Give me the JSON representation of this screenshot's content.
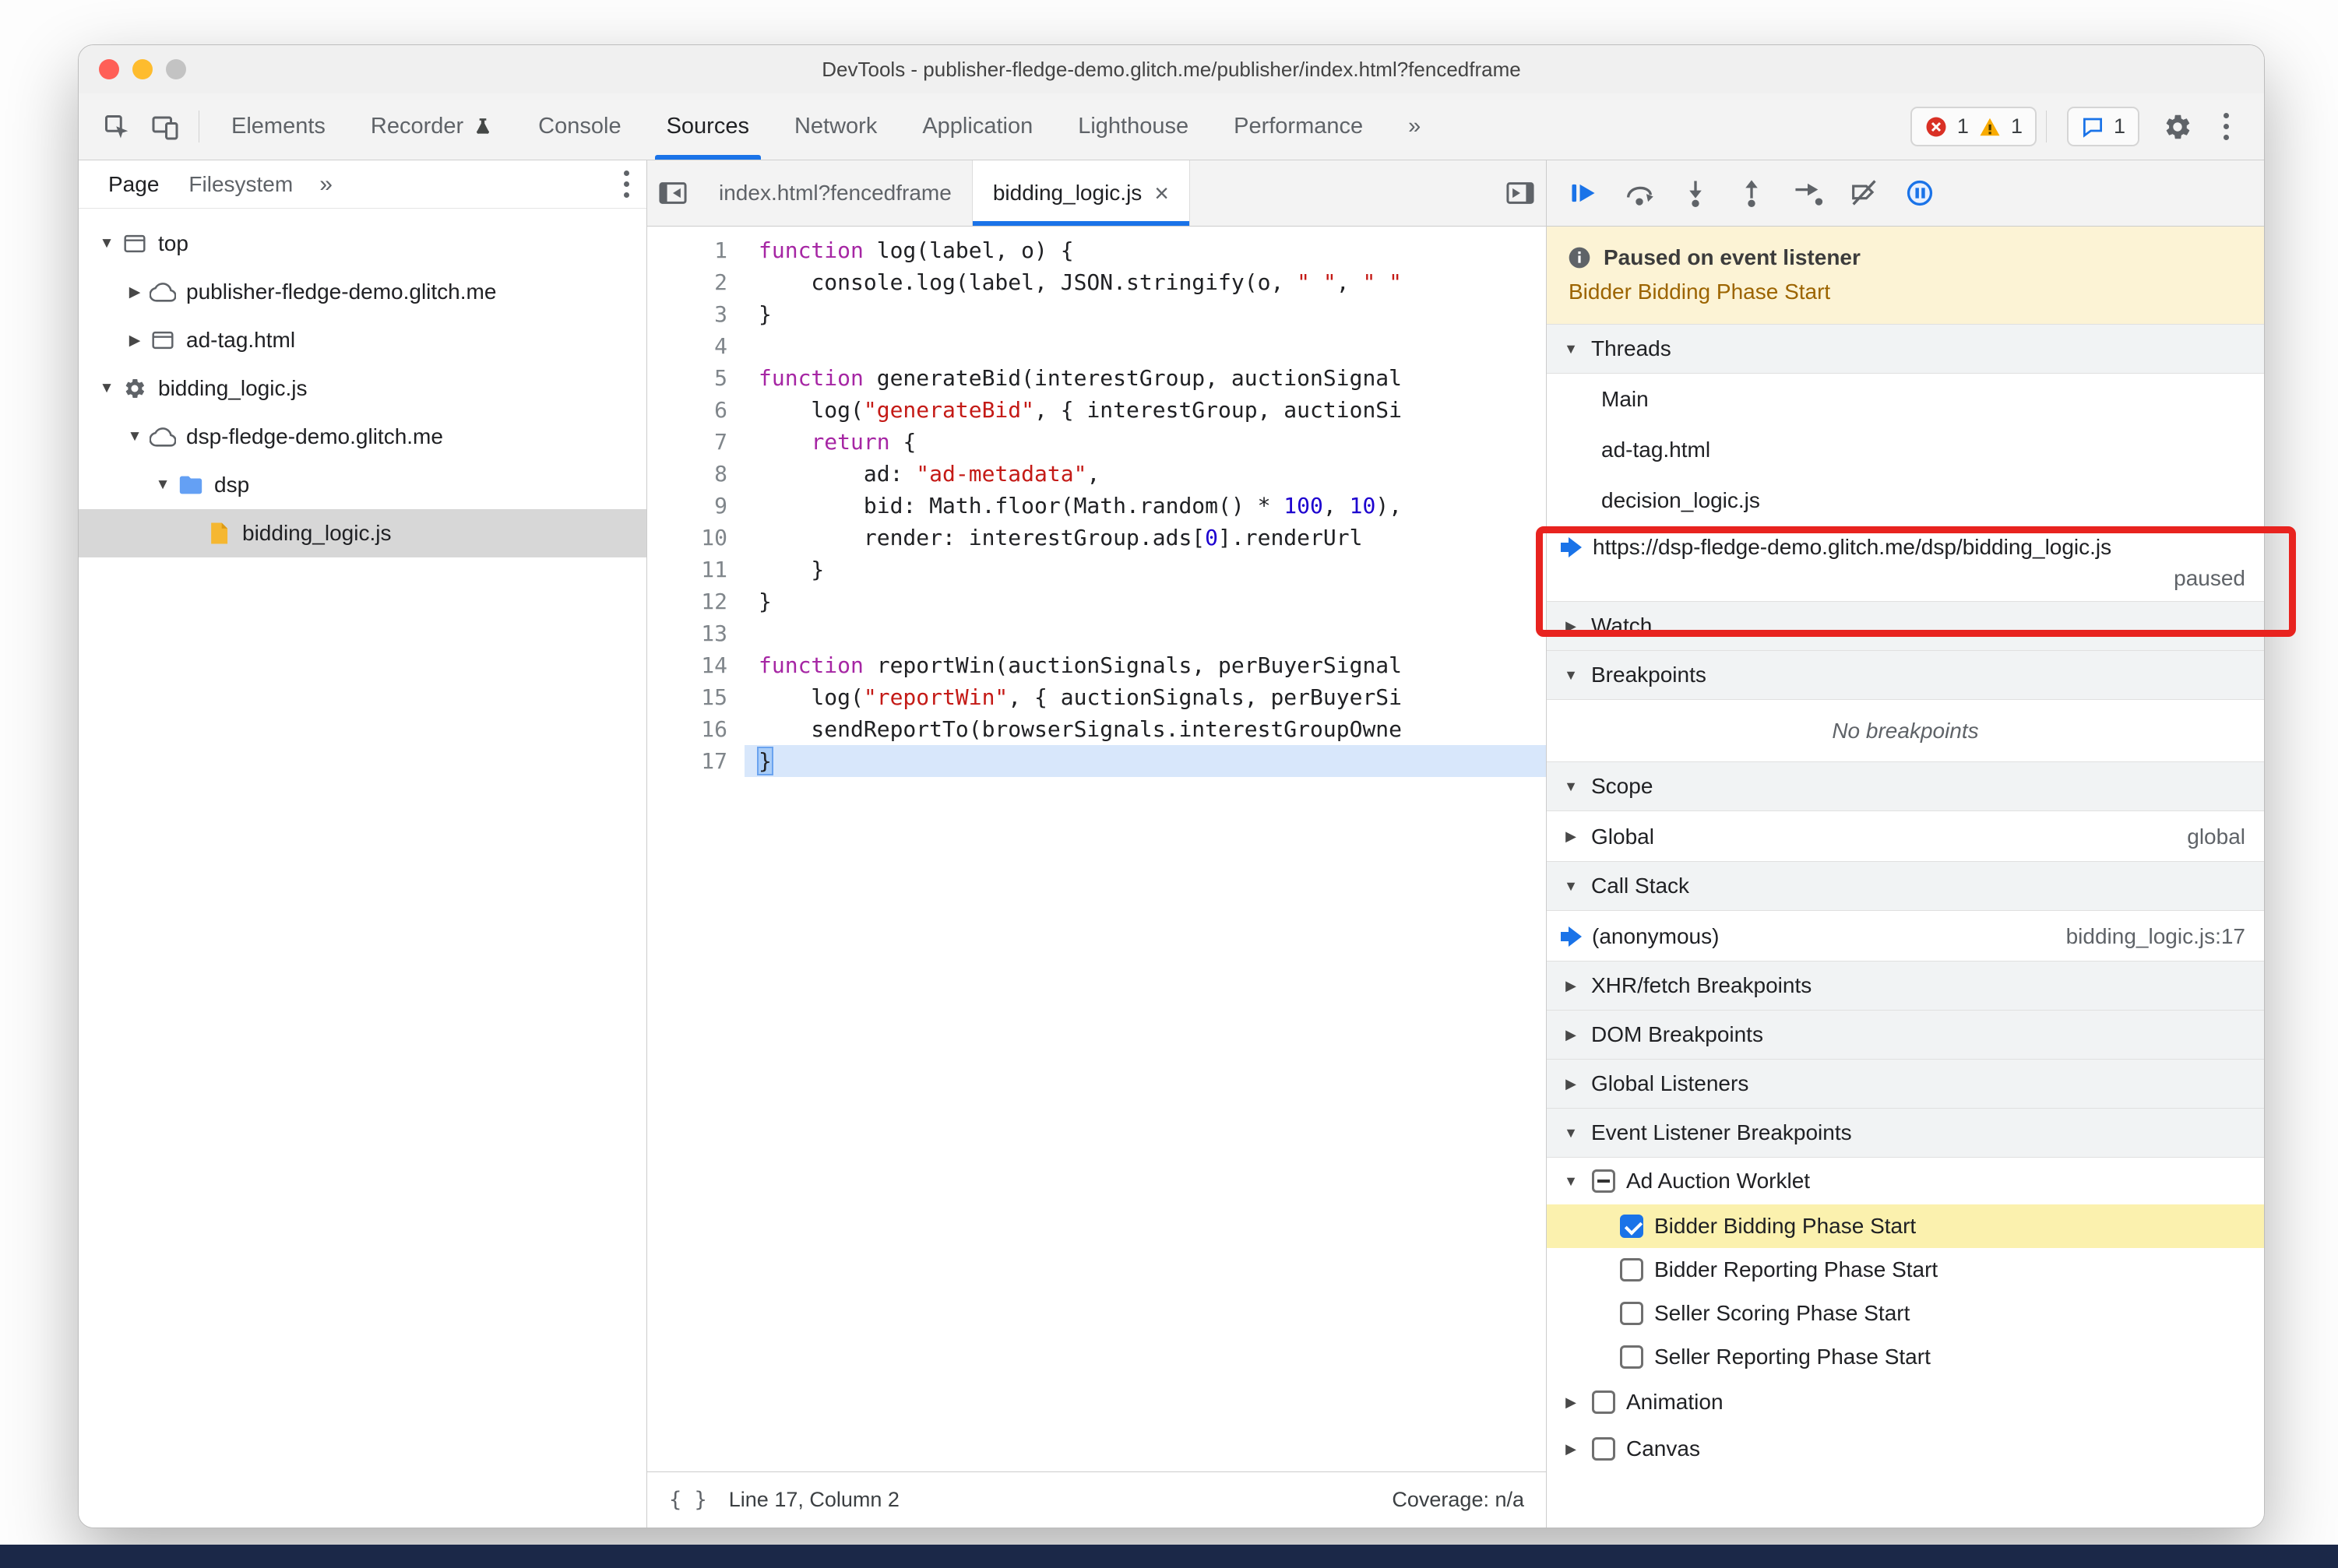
{
  "window": {
    "title": "DevTools - publisher-fledge-demo.glitch.me/publisher/index.html?fencedframe"
  },
  "toolbar": {
    "tabs": {
      "elements": "Elements",
      "recorder": "Recorder",
      "console": "Console",
      "sources": "Sources",
      "network": "Network",
      "application": "Application",
      "lighthouse": "Lighthouse",
      "performance": "Performance"
    },
    "more_tabs": "»",
    "errors": "1",
    "warnings": "1",
    "issues": "1"
  },
  "icons": {
    "inspect": "inspect-cursor-icon",
    "device": "device-toolbar-icon",
    "errors": "error-icon",
    "warnings": "warning-icon",
    "issues": "issues-bubble-icon",
    "settings": "gear-icon",
    "menu": "kebab-menu-icon"
  },
  "nav": {
    "tab_page": "Page",
    "tab_filesystem": "Filesystem",
    "more": "»",
    "tree": [
      {
        "label": "top",
        "icon": "frame-icon",
        "state": "expanded"
      },
      {
        "label": "publisher-fledge-demo.glitch.me",
        "icon": "cloud-icon",
        "state": "collapsed"
      },
      {
        "label": "ad-tag.html",
        "icon": "frame-icon",
        "state": "collapsed"
      },
      {
        "label": "bidding_logic.js",
        "icon": "worklet-gear-icon",
        "state": "expanded"
      },
      {
        "label": "dsp-fledge-demo.glitch.me",
        "icon": "cloud-icon",
        "state": "expanded"
      },
      {
        "label": "dsp",
        "icon": "folder-icon",
        "state": "expanded"
      },
      {
        "label": "bidding_logic.js",
        "icon": "script-file-icon",
        "state": "leaf",
        "selected": true
      }
    ]
  },
  "editor": {
    "tab_inactive": "index.html?fencedframe",
    "tab_active": "bidding_logic.js",
    "close_glyph": "×",
    "paused_line": "17",
    "lines": [
      {
        "n": "1",
        "tokens": [
          {
            "t": "kw",
            "v": "function"
          },
          {
            "t": "p",
            "v": " log(label, o) {"
          }
        ]
      },
      {
        "n": "2",
        "tokens": [
          {
            "t": "p",
            "v": "    console.log(label, JSON.stringify(o, "
          },
          {
            "t": "s",
            "v": "\" \""
          },
          {
            "t": "p",
            "v": ", "
          },
          {
            "t": "s",
            "v": "\" \""
          }
        ]
      },
      {
        "n": "3",
        "tokens": [
          {
            "t": "p",
            "v": "}"
          }
        ]
      },
      {
        "n": "4",
        "tokens": []
      },
      {
        "n": "5",
        "tokens": [
          {
            "t": "kw",
            "v": "function"
          },
          {
            "t": "p",
            "v": " generateBid(interestGroup, auctionSignal"
          }
        ]
      },
      {
        "n": "6",
        "tokens": [
          {
            "t": "p",
            "v": "    log("
          },
          {
            "t": "s",
            "v": "\"generateBid\""
          },
          {
            "t": "p",
            "v": ", { interestGroup, auctionSi"
          }
        ]
      },
      {
        "n": "7",
        "tokens": [
          {
            "t": "p",
            "v": "    "
          },
          {
            "t": "kw",
            "v": "return"
          },
          {
            "t": "p",
            "v": " {"
          }
        ]
      },
      {
        "n": "8",
        "tokens": [
          {
            "t": "p",
            "v": "        ad: "
          },
          {
            "t": "s",
            "v": "\"ad-metadata\""
          },
          {
            "t": "p",
            "v": ","
          }
        ]
      },
      {
        "n": "9",
        "tokens": [
          {
            "t": "p",
            "v": "        bid: Math.floor(Math.random() * "
          },
          {
            "t": "n",
            "v": "100"
          },
          {
            "t": "p",
            "v": ", "
          },
          {
            "t": "n",
            "v": "10"
          },
          {
            "t": "p",
            "v": "),"
          }
        ]
      },
      {
        "n": "10",
        "tokens": [
          {
            "t": "p",
            "v": "        render: interestGroup.ads["
          },
          {
            "t": "n",
            "v": "0"
          },
          {
            "t": "p",
            "v": "].renderUrl"
          }
        ]
      },
      {
        "n": "11",
        "tokens": [
          {
            "t": "p",
            "v": "    }"
          }
        ]
      },
      {
        "n": "12",
        "tokens": [
          {
            "t": "p",
            "v": "}"
          }
        ]
      },
      {
        "n": "13",
        "tokens": []
      },
      {
        "n": "14",
        "tokens": [
          {
            "t": "kw",
            "v": "function"
          },
          {
            "t": "p",
            "v": " reportWin(auctionSignals, perBuyerSignal"
          }
        ]
      },
      {
        "n": "15",
        "tokens": [
          {
            "t": "p",
            "v": "    log("
          },
          {
            "t": "s",
            "v": "\"reportWin\""
          },
          {
            "t": "p",
            "v": ", { auctionSignals, perBuyerSi"
          }
        ]
      },
      {
        "n": "16",
        "tokens": [
          {
            "t": "p",
            "v": "    sendReportTo(browserSignals.interestGroupOwne"
          }
        ]
      },
      {
        "n": "17",
        "tokens": [
          {
            "t": "x",
            "v": "}"
          }
        ]
      }
    ],
    "status": {
      "format_icon": "{ }",
      "line_col": "Line 17, Column 2",
      "coverage": "Coverage: n/a"
    }
  },
  "debugger": {
    "paused_title": "Paused on event listener",
    "paused_reason": "Bidder Bidding Phase Start",
    "threads": {
      "header": "Threads",
      "items": [
        "Main",
        "ad-tag.html",
        "decision_logic.js"
      ],
      "active_url": "https://dsp-fledge-demo.glitch.me/dsp/bidding_logic.js",
      "active_state": "paused"
    },
    "watch": "Watch",
    "breakpoints": {
      "header": "Breakpoints",
      "empty": "No breakpoints"
    },
    "scope": {
      "header": "Scope",
      "row_label": "Global",
      "row_value": "global"
    },
    "call_stack": {
      "header": "Call Stack",
      "frame": "(anonymous)",
      "location": "bidding_logic.js:17"
    },
    "xhr": "XHR/fetch Breakpoints",
    "dom": "DOM Breakpoints",
    "global_listeners": "Global Listeners",
    "event_listener_breakpoints": {
      "header": "Event Listener Breakpoints",
      "group": "Ad Auction Worklet",
      "items": [
        {
          "label": "Bidder Bidding Phase Start",
          "checked": true,
          "highlighted": true
        },
        {
          "label": "Bidder Reporting Phase Start",
          "checked": false
        },
        {
          "label": "Seller Scoring Phase Start",
          "checked": false
        },
        {
          "label": "Seller Reporting Phase Start",
          "checked": false
        }
      ],
      "collapsed_groups": [
        "Animation",
        "Canvas"
      ]
    }
  },
  "colors": {
    "accent": "#1a73e8",
    "annotation": "#e8231f",
    "paused_banner_bg": "#fcf3d5",
    "highlight_row_bg": "#fbf1ae"
  }
}
